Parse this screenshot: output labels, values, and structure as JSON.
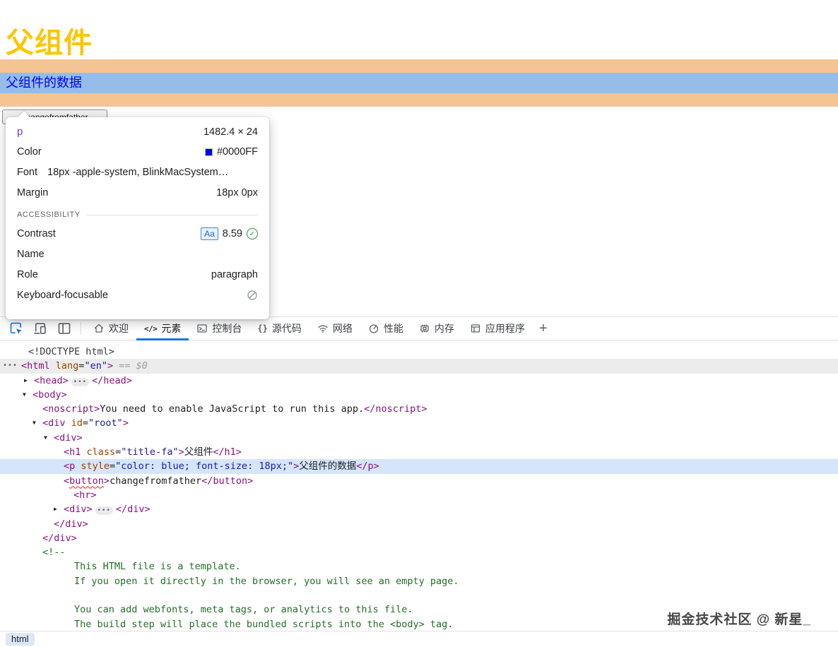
{
  "accent": {
    "blue": "#1a73e8",
    "highlight_orange": "#f5c493",
    "highlight_blue": "#95bde7"
  },
  "page": {
    "heading": "父组件",
    "paragraph": "父组件的数据",
    "button_label": "changefromfather"
  },
  "inspect_tooltip": {
    "tag": "p",
    "dimensions": "1482.4 × 24",
    "color_label": "Color",
    "color_value": "#0000FF",
    "color_hex": "#0000FF",
    "font_label": "Font",
    "font_value": "18px -apple-system, BlinkMacSystem…",
    "margin_label": "Margin",
    "margin_value": "18px 0px",
    "accessibility_label": "ACCESSIBILITY",
    "contrast_label": "Contrast",
    "contrast_sample": "Aa",
    "contrast_value": "8.59",
    "name_label": "Name",
    "role_label": "Role",
    "role_value": "paragraph",
    "keyboard_label": "Keyboard-focusable"
  },
  "devtools": {
    "toolbar_icons": [
      "inspect-icon",
      "device-toolbar-icon",
      "dock-side-icon"
    ],
    "tabs": [
      {
        "id": "welcome",
        "icon": "home-icon",
        "label": "欢迎",
        "active": false
      },
      {
        "id": "elements",
        "icon": "code-icon",
        "label": "元素",
        "active": true
      },
      {
        "id": "console",
        "icon": "console-icon",
        "label": "控制台",
        "active": false
      },
      {
        "id": "sources",
        "icon": "sources-icon",
        "label": "源代码",
        "active": false
      },
      {
        "id": "network",
        "icon": "network-icon",
        "label": "网络",
        "active": false
      },
      {
        "id": "performance",
        "icon": "performance-icon",
        "label": "性能",
        "active": false
      },
      {
        "id": "memory",
        "icon": "memory-icon",
        "label": "内存",
        "active": false
      },
      {
        "id": "application",
        "icon": "application-icon",
        "label": "应用程序",
        "active": false
      }
    ],
    "new_tab_label": "+"
  },
  "elements_tree": {
    "lines": [
      {
        "indent": 40,
        "tokens": [
          [
            "doctype",
            "<!DOCTYPE html>"
          ]
        ]
      },
      {
        "indent": 30,
        "highlight": "gray",
        "left_dots": true,
        "tokens": [
          [
            "tag",
            "<html "
          ],
          [
            "attr",
            "lang"
          ],
          [
            "plain",
            "="
          ],
          [
            "val",
            "\"en\""
          ],
          [
            "tag",
            ">"
          ],
          [
            "dim",
            " == $0"
          ]
        ]
      },
      {
        "indent": 48,
        "arrow": "collapsed",
        "tokens": [
          [
            "tag",
            "<head>"
          ],
          [
            "dots",
            "•••"
          ],
          [
            "tag",
            "</head>"
          ]
        ]
      },
      {
        "indent": 46,
        "arrow": "expanded",
        "tokens": [
          [
            "tag",
            "<body>"
          ]
        ]
      },
      {
        "indent": 60,
        "tokens": [
          [
            "tag",
            "<noscript>"
          ],
          [
            "text",
            "You need to enable JavaScript to run this app."
          ],
          [
            "tag",
            "</noscript>"
          ]
        ]
      },
      {
        "indent": 60,
        "arrow": "expanded",
        "tokens": [
          [
            "tag",
            "<div "
          ],
          [
            "attr",
            "id"
          ],
          [
            "plain",
            "="
          ],
          [
            "val",
            "\"root\""
          ],
          [
            "tag",
            ">"
          ]
        ]
      },
      {
        "indent": 76,
        "arrow": "expanded",
        "tokens": [
          [
            "tag",
            "<div>"
          ]
        ]
      },
      {
        "indent": 90,
        "tokens": [
          [
            "tag",
            "<h1 "
          ],
          [
            "attr",
            "class"
          ],
          [
            "plain",
            "="
          ],
          [
            "val",
            "\"title-fa\""
          ],
          [
            "tag",
            ">"
          ],
          [
            "text",
            "父组件"
          ],
          [
            "tag",
            "</h1>"
          ]
        ]
      },
      {
        "indent": 90,
        "highlight": "blue",
        "tokens": [
          [
            "tag",
            "<p "
          ],
          [
            "attr",
            "style"
          ],
          [
            "plain",
            "="
          ],
          [
            "val",
            "\"color: blue; font-size: 18px;\""
          ],
          [
            "tag",
            ">"
          ],
          [
            "text",
            "父组件的数据"
          ],
          [
            "tag",
            "</p>"
          ]
        ]
      },
      {
        "indent": 90,
        "tokens": [
          [
            "tag",
            "<"
          ],
          [
            "tag-error",
            "button"
          ],
          [
            "tag",
            ">"
          ],
          [
            "text",
            "changefromfather"
          ],
          [
            "tag",
            "</button>"
          ]
        ]
      },
      {
        "indent": 104,
        "tokens": [
          [
            "tag",
            "<hr>"
          ]
        ]
      },
      {
        "indent": 90,
        "arrow": "collapsed",
        "tokens": [
          [
            "tag",
            "<div>"
          ],
          [
            "dots",
            "•••"
          ],
          [
            "tag",
            "</div>"
          ]
        ]
      },
      {
        "indent": 76,
        "tokens": [
          [
            "tag",
            "</div>"
          ]
        ]
      },
      {
        "indent": 60,
        "tokens": [
          [
            "tag",
            "</div>"
          ]
        ]
      },
      {
        "indent": 60,
        "tokens": [
          [
            "comment",
            "<!--"
          ]
        ]
      },
      {
        "indent": 105,
        "tokens": [
          [
            "comment",
            "This HTML file is a template."
          ]
        ]
      },
      {
        "indent": 105,
        "tokens": [
          [
            "comment",
            "If you open it directly in the browser, you will see an empty page."
          ]
        ]
      },
      {
        "indent": 105,
        "tokens": []
      },
      {
        "indent": 105,
        "tokens": [
          [
            "comment",
            "You can add webfonts, meta tags, or analytics to this file."
          ]
        ]
      },
      {
        "indent": 105,
        "tokens": [
          [
            "comment",
            "The build step will place the bundled scripts into the <body> tag."
          ]
        ]
      }
    ]
  },
  "statusbar": {
    "breadcrumb": "html"
  },
  "watermark": "掘金技术社区 @ 新星_"
}
